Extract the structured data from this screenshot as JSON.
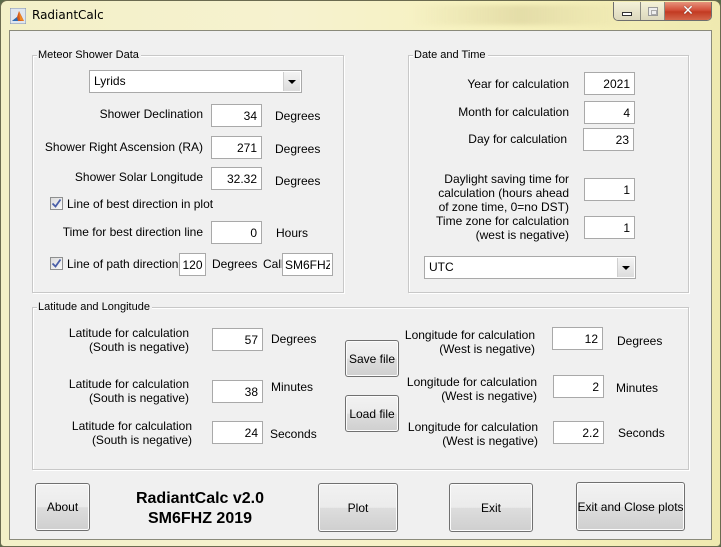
{
  "window": {
    "title": "RadiantCalc",
    "controls": {
      "minimize": "minimize",
      "maximize": "maximize",
      "close": "✕"
    }
  },
  "meteor_shower": {
    "panel_title": "Meteor Shower Data",
    "shower_select": {
      "selected": "Lyrids"
    },
    "declination": {
      "label": "Shower Declination",
      "value": "34",
      "unit": "Degrees"
    },
    "right_ascension": {
      "label": "Shower Right Ascension (RA)",
      "value": "271",
      "unit": "Degrees"
    },
    "solar_longitude": {
      "label": "Shower Solar Longitude",
      "value": "32.32",
      "unit": "Degrees"
    },
    "best_direction_checkbox": {
      "label": "Line of best direction in plot",
      "checked": true
    },
    "best_direction_time": {
      "label": "Time for best direction line",
      "value": "0",
      "unit": "Hours"
    },
    "path_direction_checkbox": {
      "label": "Line of path direction",
      "checked": true
    },
    "path_direction": {
      "value": "120",
      "unit": "Degrees"
    },
    "call": {
      "label": "Call",
      "value": "SM6FHZ"
    }
  },
  "date_time": {
    "panel_title": "Date and Time",
    "year": {
      "label": "Year for calculation",
      "value": "2021"
    },
    "month": {
      "label": "Month for calculation",
      "value": "4"
    },
    "day": {
      "label": "Day for calculation",
      "value": "23"
    },
    "dst": {
      "label_lines": [
        "Daylight saving time for",
        "calculation (hours ahead",
        "of zone time, 0=no DST)"
      ],
      "value": "1"
    },
    "time_zone": {
      "label_lines": [
        "Time zone for calculation",
        "(west is negative)"
      ],
      "value": "1"
    },
    "time_select": {
      "selected": "UTC"
    }
  },
  "lat_lon": {
    "panel_title": "Latitude and Longitude",
    "lat_degrees": {
      "label_lines": [
        "Latitude for calculation",
        "(South is negative)"
      ],
      "value": "57",
      "unit": "Degrees"
    },
    "lat_minutes": {
      "label_lines": [
        "Latitude for calculation",
        "(South is negative)"
      ],
      "value": "38",
      "unit": "Minutes"
    },
    "lat_seconds": {
      "label_lines": [
        "Latitude for calculation",
        "(South is negative)"
      ],
      "value": "24",
      "unit": "Seconds"
    },
    "lon_degrees": {
      "label_lines": [
        "Longitude for calculation",
        "(West is negative)"
      ],
      "value": "12",
      "unit": "Degrees"
    },
    "lon_minutes": {
      "label_lines": [
        "Longitude for calculation",
        "(West is negative)"
      ],
      "value": "2",
      "unit": "Minutes"
    },
    "lon_seconds": {
      "label_lines": [
        "Longitude for calculation",
        "(West is negative)"
      ],
      "value": "2.2",
      "unit": "Seconds"
    },
    "save_button": "Save file",
    "load_button": "Load file"
  },
  "footer": {
    "about_button": "About",
    "app_name": "RadiantCalc v2.0",
    "credit": "SM6FHZ 2019",
    "plot_button": "Plot",
    "exit_button": "Exit",
    "exit_close_button": "Exit and Close plots"
  }
}
